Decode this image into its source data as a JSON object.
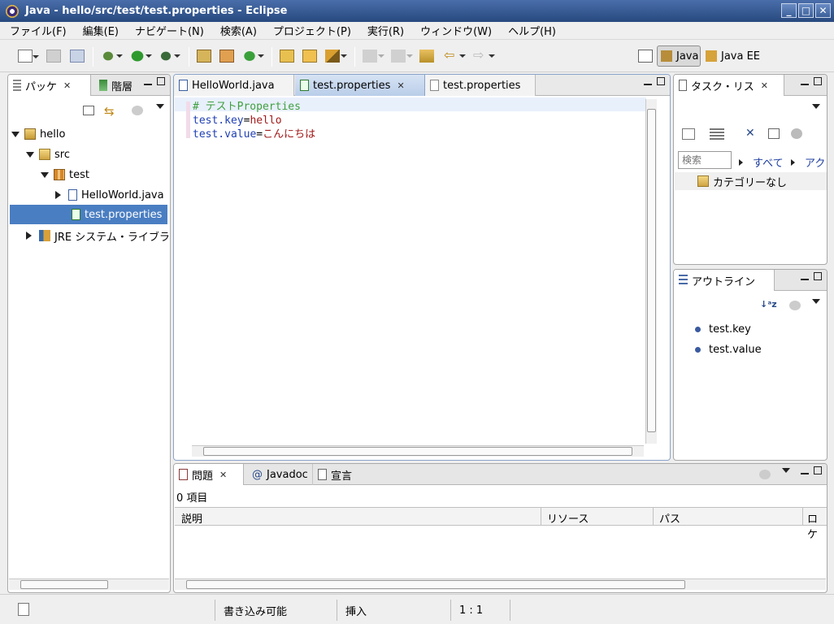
{
  "window": {
    "title": "Java - hello/src/test/test.properties - Eclipse"
  },
  "menu": [
    "ファイル(F)",
    "編集(E)",
    "ナビゲート(N)",
    "検索(A)",
    "プロジェクト(P)",
    "実行(R)",
    "ウィンドウ(W)",
    "ヘルプ(H)"
  ],
  "perspectives": {
    "java": "Java",
    "java_ee": "Java EE"
  },
  "left": {
    "tabs": [
      "パッケ",
      "階層"
    ],
    "tree": {
      "project": "hello",
      "src": "src",
      "package": "test",
      "java_file": "HelloWorld.java",
      "props_file": "test.properties",
      "jre": "JRE システム・ライブラ"
    }
  },
  "editor": {
    "tabs": [
      "HelloWorld.java",
      "test.properties",
      "test.properties"
    ],
    "lines": {
      "comment": "# テストProperties",
      "k1": "test.key",
      "v1": "hello",
      "k2": "test.value",
      "v2": "こんにちは",
      "eq": "="
    }
  },
  "tasks": {
    "tab": "タスク・リス",
    "search_placeholder": "検索",
    "all": "すべて",
    "active": "アク",
    "uncategorized": "カテゴリーなし"
  },
  "outline": {
    "tab": "アウトライン",
    "items": [
      "test.key",
      "test.value"
    ]
  },
  "problems": {
    "tabs": [
      "問題",
      "Javadoc",
      "宣言"
    ],
    "count": "0 項目",
    "columns": [
      "説明",
      "リソース",
      "パス",
      "ロケ"
    ]
  },
  "status": {
    "writable": "書き込み可能",
    "insert": "挿入",
    "position": "1 : 1"
  },
  "colors": {
    "selection": "#4a7ec2",
    "title_bar": "#27497f",
    "comment": "#3f9f3f",
    "key": "#1f3fb3",
    "value": "#a11a1a"
  }
}
